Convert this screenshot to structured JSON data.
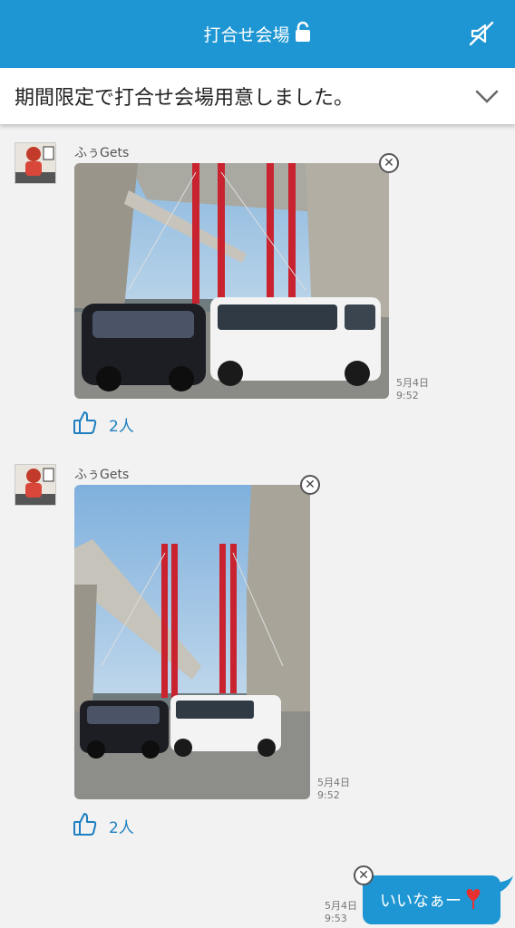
{
  "header": {
    "title": "打合せ会場"
  },
  "banner": {
    "text": "期間限定で打合せ会場用意しました。"
  },
  "messages": [
    {
      "user": "ふぅGets",
      "date": "5月4日",
      "time": "9:52",
      "likes": "2人"
    },
    {
      "user": "ふぅGets",
      "date": "5月4日",
      "time": "9:52",
      "likes": "2人"
    }
  ],
  "my_message": {
    "text": "いいなぁー",
    "date": "5月4日",
    "time": "9:53"
  },
  "colors": {
    "accent": "#1e96d3",
    "background": "#f2f2f2"
  },
  "icons": [
    "lock-icon",
    "mute-icon",
    "chevron-down-icon",
    "thumbs-up-icon",
    "close-icon",
    "heart-icon"
  ]
}
